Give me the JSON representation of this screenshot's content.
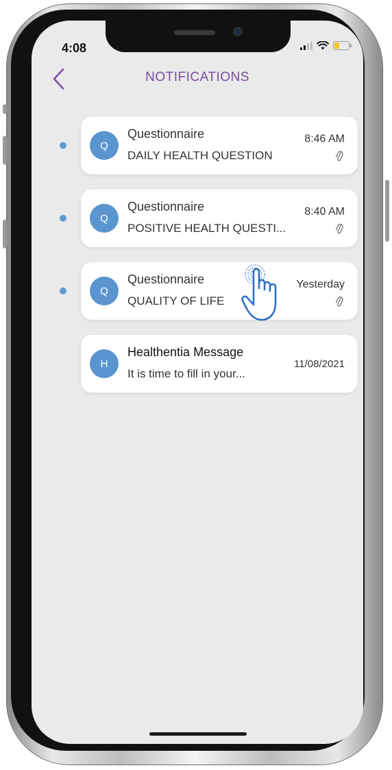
{
  "status_bar": {
    "time": "4:08"
  },
  "header": {
    "title": "NOTIFICATIONS"
  },
  "notifications": [
    {
      "avatar_letter": "Q",
      "title": "Questionnaire",
      "subtitle": "DAILY HEALTH QUESTION",
      "time": "8:46 AM",
      "unread": true,
      "has_attachment": true
    },
    {
      "avatar_letter": "Q",
      "title": "Questionnaire",
      "subtitle": "POSITIVE HEALTH QUESTI...",
      "time": "8:40 AM",
      "unread": true,
      "has_attachment": true
    },
    {
      "avatar_letter": "Q",
      "title": "Questionnaire",
      "subtitle": "QUALITY OF LIFE",
      "time": "Yesterday",
      "unread": true,
      "has_attachment": true
    },
    {
      "avatar_letter": "H",
      "title": "Healthentia Message",
      "subtitle": "It is time to fill in your...",
      "time": "11/08/2021",
      "unread": false,
      "has_attachment": false
    }
  ],
  "colors": {
    "accent": "#7a4aa0",
    "unread_dot": "#5b9bd5",
    "avatar": "#5b95cf",
    "background": "#ebeaeb"
  },
  "icons": {
    "back": "chevron-left-icon",
    "attachment": "paperclip-icon",
    "tap_hint": "tap-hand-icon"
  }
}
